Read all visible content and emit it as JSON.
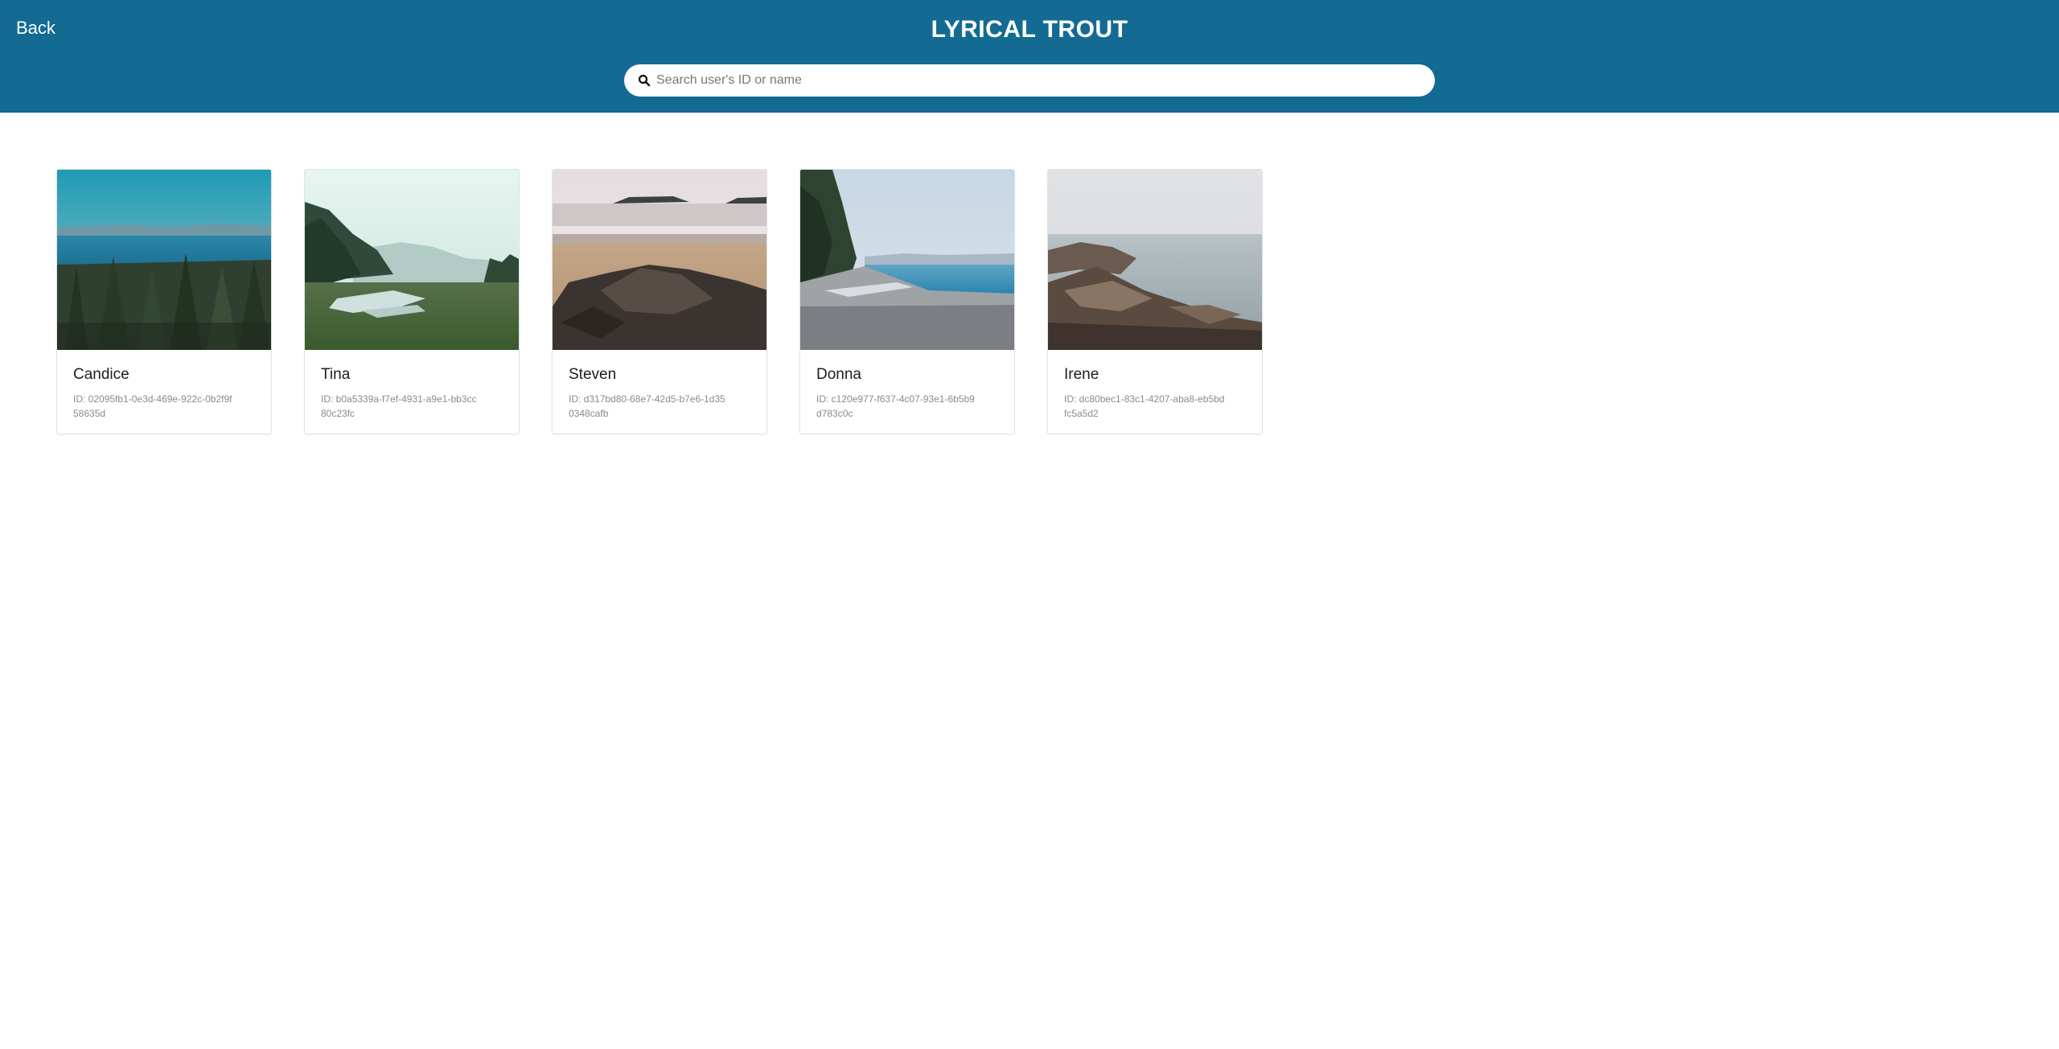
{
  "header": {
    "back_label": "Back",
    "title": "LYRICAL TROUT",
    "bg_color": "#136b93"
  },
  "search": {
    "placeholder": "Search user's ID or name",
    "value": "",
    "icon": "search-icon"
  },
  "users": [
    {
      "name": "Candice",
      "id_text": "ID: 02095fb1-0e3d-469e-922c-0b2f9f58635d",
      "photo": "forest-lake-landscape"
    },
    {
      "name": "Tina",
      "id_text": "ID: b0a5339a-f7ef-4931-a9e1-bb3cc80c23fc",
      "photo": "misty-valley-river"
    },
    {
      "name": "Steven",
      "id_text": "ID: d317bd80-68e7-42d5-b7e6-1d350348cafb",
      "photo": "sandy-beach-rocks"
    },
    {
      "name": "Donna",
      "id_text": "ID: c120e977-f637-4c07-93e1-6b5b9d783c0c",
      "photo": "pebble-shore-trees"
    },
    {
      "name": "Irene",
      "id_text": "ID: dc80bec1-83c1-4207-aba8-eb5bdfc5a5d2",
      "photo": "rocky-coast-sea"
    }
  ]
}
